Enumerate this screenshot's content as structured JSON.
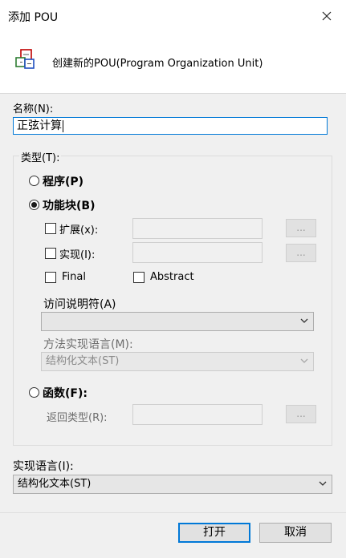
{
  "window": {
    "title": "添加 POU",
    "close_glyph": "✕"
  },
  "header": {
    "icon": "pou-icon",
    "description": "创建新的POU(Program Organization Unit)"
  },
  "name": {
    "label": "名称(N):",
    "value": "正弦计算"
  },
  "type_group": {
    "label": "类型(T):",
    "program": {
      "label": "程序(P)",
      "checked": false
    },
    "function_block": {
      "label": "功能块(B)",
      "checked": true,
      "extends": {
        "label": "扩展(x):",
        "value": "",
        "browse": "..."
      },
      "implements": {
        "label": "实现(I):",
        "value": "",
        "browse": "..."
      },
      "final": {
        "label": "Final",
        "checked": false
      },
      "abstract": {
        "label": "Abstract",
        "checked": false
      },
      "access_specifier": {
        "label": "访问说明符(A)",
        "value": ""
      },
      "method_language": {
        "label": "方法实现语言(M):",
        "value": "结构化文本(ST)"
      }
    },
    "function": {
      "label": "函数(F):",
      "checked": false,
      "return_type": {
        "label": "返回类型(R):",
        "value": "",
        "browse": "..."
      }
    }
  },
  "implementation_language": {
    "label": "实现语言(I):",
    "value": "结构化文本(ST)"
  },
  "buttons": {
    "open": "打开",
    "cancel": "取消"
  }
}
